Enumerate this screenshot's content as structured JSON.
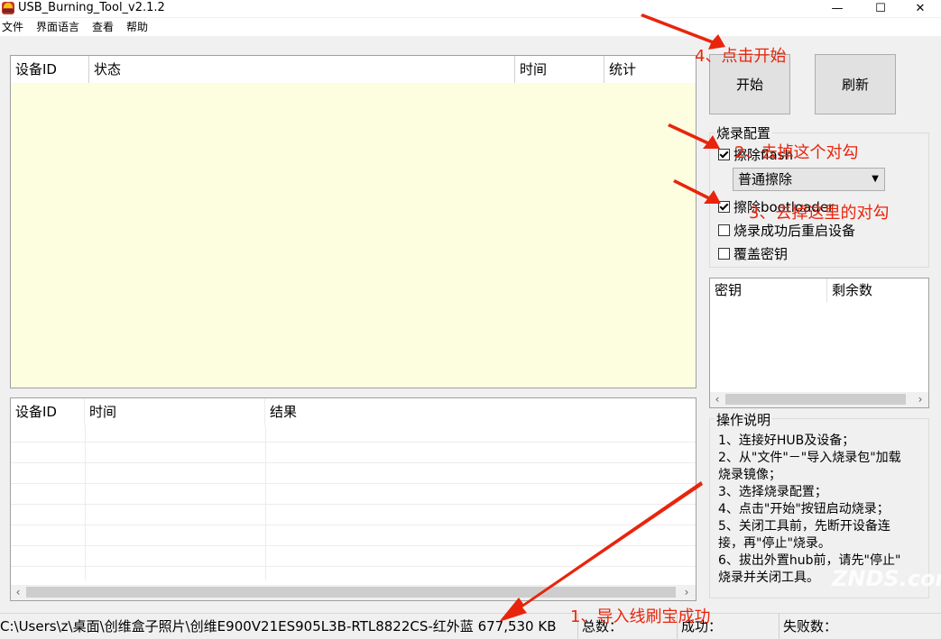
{
  "window": {
    "title": "USB_Burning_Tool_v2.1.2",
    "controls": {
      "minimize": "—",
      "maximize": "☐",
      "close": "✕"
    }
  },
  "menu": [
    "文件",
    "界面语言",
    "查看",
    "帮助"
  ],
  "device_table": {
    "columns": [
      "设备ID",
      "状态",
      "时间",
      "统计"
    ],
    "bg_color": "#fdfde0"
  },
  "result_table": {
    "columns": [
      "设备ID",
      "时间",
      "结果"
    ]
  },
  "buttons": {
    "start": "开始",
    "refresh": "刷新"
  },
  "burn_config": {
    "title": "烧录配置",
    "erase_flash": {
      "label": "擦除flash",
      "checked": true
    },
    "erase_mode": "普通擦除",
    "erase_bootloader": {
      "label": "擦除bootloader",
      "checked": true
    },
    "reboot_after": {
      "label": "烧录成功后重启设备",
      "checked": false
    },
    "overwrite_key": {
      "label": "覆盖密钥",
      "checked": false
    }
  },
  "key_table": {
    "columns": [
      "密钥",
      "剩余数"
    ]
  },
  "instructions": {
    "title": "操作说明",
    "lines": [
      "1、连接好HUB及设备；",
      "2、从\"文件\"－\"导入烧录包\"加载",
      "烧录镜像；",
      "3、选择烧录配置；",
      "4、点击\"开始\"按钮启动烧录；",
      "5、关闭工具前，先断开设备连",
      "接，再\"停止\"烧录。",
      "6、拔出外置hub前，请先\"停止\"",
      "烧录并关闭工具。"
    ]
  },
  "status_bar": {
    "path": "C:\\Users\\z\\桌面\\创维盒子照片\\创维E900V21ES905L3B-RTL8822CS-红外蓝 677,530 KB",
    "total": "总数：",
    "success": "成功：",
    "failed": "失败数："
  },
  "annotations": {
    "a1": "1、导入线刷宝成功",
    "a2": "2、去掉这个对勾",
    "a3": "3、去掉这里的对勾",
    "a4": "4、点击开始",
    "color": "#e8250c"
  },
  "watermark": "ZNDS.com"
}
